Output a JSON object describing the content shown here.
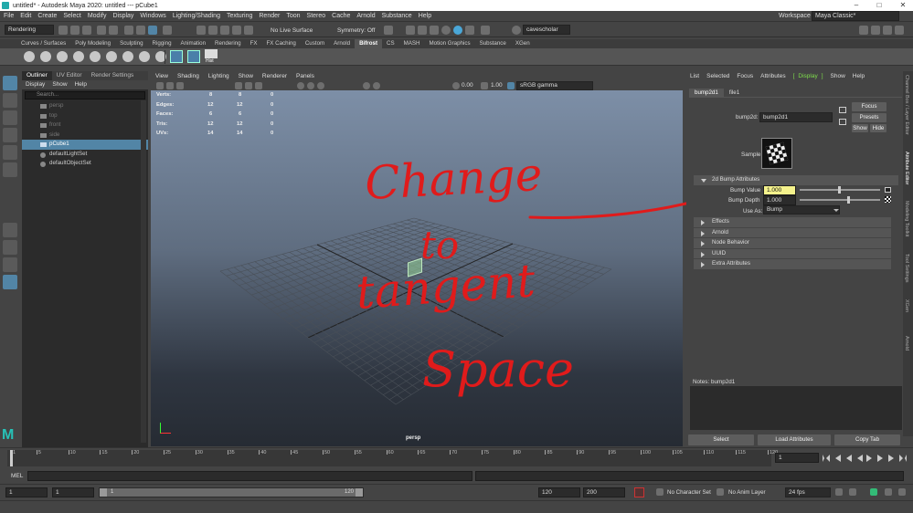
{
  "window": {
    "title": "untitled* - Autodesk Maya 2020: untitled   ---   pCube1"
  },
  "menus": [
    "File",
    "Edit",
    "Create",
    "Select",
    "Modify",
    "Display",
    "Windows",
    "Lighting/Shading",
    "Texturing",
    "Render",
    "Toon",
    "Stereo",
    "Cache",
    "Arnold",
    "Substance",
    "Help"
  ],
  "workspace": {
    "label": "Workspace :",
    "value": "Maya Classic*"
  },
  "status_line": {
    "menu_set": "Rendering",
    "live_surface": "No Live Surface",
    "symmetry": "Symmetry: Off",
    "user": "cavescholar"
  },
  "shelf_tabs": [
    {
      "label": "Curves / Surfaces",
      "active": false
    },
    {
      "label": "Poly Modeling",
      "active": false
    },
    {
      "label": "Sculpting",
      "active": false
    },
    {
      "label": "Rigging",
      "active": false
    },
    {
      "label": "Animation",
      "active": false
    },
    {
      "label": "Rendering",
      "active": false
    },
    {
      "label": "FX",
      "active": false
    },
    {
      "label": "FX Caching",
      "active": false
    },
    {
      "label": "Custom",
      "active": false
    },
    {
      "label": "Arnold",
      "active": false
    },
    {
      "label": "Bifrost",
      "active": true
    },
    {
      "label": "CS",
      "active": false
    },
    {
      "label": "MASH",
      "active": false
    },
    {
      "label": "Motion Graphics",
      "active": false
    },
    {
      "label": "Substance",
      "active": false
    },
    {
      "label": "XGen",
      "active": false
    }
  ],
  "shelf_hist_label": "Hist",
  "outliner": {
    "tabs": [
      "Outliner",
      "UV Editor",
      "Render Settings"
    ],
    "menu": [
      "Display",
      "Show",
      "Help"
    ],
    "search_placeholder": "Search...",
    "items": [
      {
        "label": "persp",
        "dim": true,
        "selected": false
      },
      {
        "label": "top",
        "dim": true,
        "selected": false
      },
      {
        "label": "front",
        "dim": true,
        "selected": false
      },
      {
        "label": "side",
        "dim": true,
        "selected": false
      },
      {
        "label": "pCube1",
        "dim": false,
        "selected": true
      },
      {
        "label": "defaultLightSet",
        "dim": false,
        "selected": false
      },
      {
        "label": "defaultObjectSet",
        "dim": false,
        "selected": false
      }
    ]
  },
  "viewport": {
    "menu": [
      "View",
      "Shading",
      "Lighting",
      "Show",
      "Renderer",
      "Panels"
    ],
    "exposure": "0.00",
    "gamma": "1.00",
    "color_space": "sRGB gamma",
    "camera_label": "persp",
    "hud": [
      {
        "label": "Verts:",
        "v1": "8",
        "v2": "8",
        "v3": "0"
      },
      {
        "label": "Edges:",
        "v1": "12",
        "v2": "12",
        "v3": "0"
      },
      {
        "label": "Faces:",
        "v1": "6",
        "v2": "6",
        "v3": "0"
      },
      {
        "label": "Tris:",
        "v1": "12",
        "v2": "12",
        "v3": "0"
      },
      {
        "label": "UVs:",
        "v1": "14",
        "v2": "14",
        "v3": "0"
      }
    ],
    "annotation_lines": [
      "Change",
      "to",
      "tangent",
      "Space"
    ]
  },
  "attribute_editor": {
    "menu": [
      "List",
      "Selected",
      "Focus",
      "Attributes",
      "Display",
      "Show",
      "Help"
    ],
    "highlighted_menu": "Display",
    "tabs": [
      "bump2d1",
      "file1"
    ],
    "node_label": "bump2d:",
    "node_name": "bump2d1",
    "buttons": {
      "focus": "Focus",
      "presets": "Presets",
      "show": "Show",
      "hide": "Hide"
    },
    "sample_label": "Sample",
    "section_open": "2d Bump Attributes",
    "bump_value_label": "Bump Value",
    "bump_value": "1.000",
    "bump_depth_label": "Bump Depth",
    "bump_depth": "1.000",
    "use_as_label": "Use As:",
    "use_as_value": "Bump",
    "sections": [
      "Effects",
      "Arnold",
      "Node Behavior",
      "UUID",
      "Extra Attributes"
    ],
    "notes_label": "Notes:  bump2d1",
    "bottom_buttons": [
      "Select",
      "Load Attributes",
      "Copy Tab"
    ]
  },
  "right_tabs": [
    "Channel Box / Layer Editor",
    "Attribute Editor",
    "Modeling Toolkit",
    "Tool Settings",
    "XGen",
    "Arnold"
  ],
  "right_tabs_active": "Attribute Editor",
  "timeline": {
    "ticks": [
      1,
      5,
      10,
      15,
      20,
      25,
      30,
      35,
      40,
      45,
      50,
      55,
      60,
      65,
      70,
      75,
      80,
      85,
      90,
      95,
      100,
      105,
      110,
      115,
      120
    ],
    "current_frame": "1"
  },
  "command_line": {
    "label": "MEL"
  },
  "range": {
    "start": "1",
    "playback_start": "1",
    "slider_start": "1",
    "slider_end": "120",
    "playback_end": "120",
    "end": "200",
    "character_set": "No Character Set",
    "anim_layer": "No Anim Layer",
    "fps": "24 fps"
  }
}
